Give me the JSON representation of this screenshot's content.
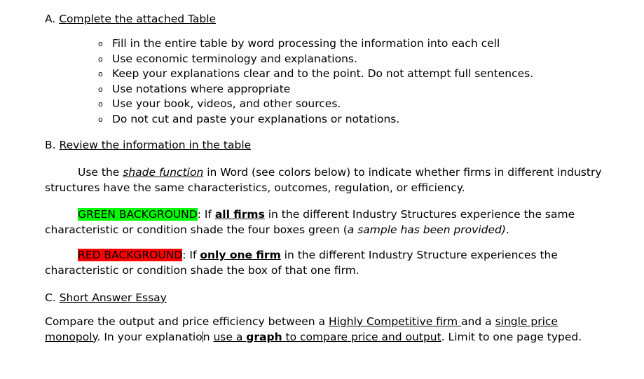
{
  "document": {
    "sections": [
      {
        "letter": "A.",
        "title": "Complete the attached Table"
      },
      {
        "letter": "B.",
        "title": "Review the information in the table"
      },
      {
        "letter": "C.",
        "title": "Short Answer Essay"
      }
    ],
    "bullets": {
      "marker": "o",
      "items": [
        "Fill in the entire table by word processing the information into each cell",
        "Use economic terminology and explanations.",
        "Keep your explanations clear and to the point. Do not attempt full sentences.",
        "Use notations where appropriate",
        "Use your book, videos, and other sources.",
        "Do not cut and paste your explanations or notations."
      ]
    },
    "shade_paragraph": {
      "part1": "Use the ",
      "emphasis": "shade function",
      "part2": " in Word (see colors below) to indicate whether firms in different industry structures have the same characteristics, outcomes, regulation, or efficiency."
    },
    "green_rule": {
      "highlight": "GREEN BACKGROUND",
      "part1": ": If ",
      "emphasis": "all firms",
      "part2": " in the different Industry Structures experience the same characteristic or condition shade the four boxes green (",
      "italic_note": "a sample has been provided)",
      "part3": "."
    },
    "red_rule": {
      "highlight": "RED BACKGROUND",
      "part1": ": If ",
      "emphasis": "only one firm",
      "part2": " in the different Industry Structure experiences the characteristic or condition shade the box of that one firm."
    },
    "essay_paragraph": {
      "part1": "Compare the output and price efficiency between a ",
      "link1": "Highly Competitive firm ",
      "part2": "and a ",
      "link2": "single price monopoly",
      "part3": ". In your explanatio",
      "part3b": "n ",
      "link3a": "use a ",
      "link3b": "graph",
      "link3c": " to compare price and output",
      "part4": ". Limit to one page typed."
    },
    "colors": {
      "green_highlight": "#00ff00",
      "red_highlight": "#ff0000",
      "text": "#000000",
      "background": "#ffffff"
    }
  }
}
